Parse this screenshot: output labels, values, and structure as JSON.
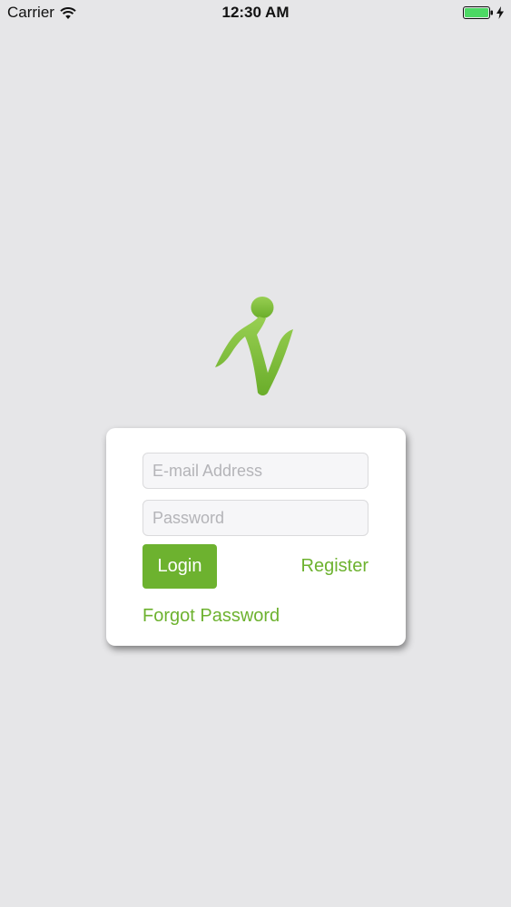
{
  "status_bar": {
    "carrier": "Carrier",
    "time": "12:30 AM",
    "wifi_icon": "wifi-icon",
    "battery_icon": "battery-icon",
    "charging_icon": "bolt-icon",
    "battery_level": 1.0
  },
  "logo": {
    "icon": "brand-logo-icon",
    "color": "#7ab83a"
  },
  "login_form": {
    "email": {
      "placeholder": "E-mail Address",
      "value": ""
    },
    "password": {
      "placeholder": "Password",
      "value": ""
    },
    "login_label": "Login",
    "register_label": "Register",
    "forgot_label": "Forgot Password"
  },
  "colors": {
    "accent": "#6db22f",
    "background": "#e6e6e8",
    "card": "#ffffff",
    "battery": "#4cd964"
  }
}
